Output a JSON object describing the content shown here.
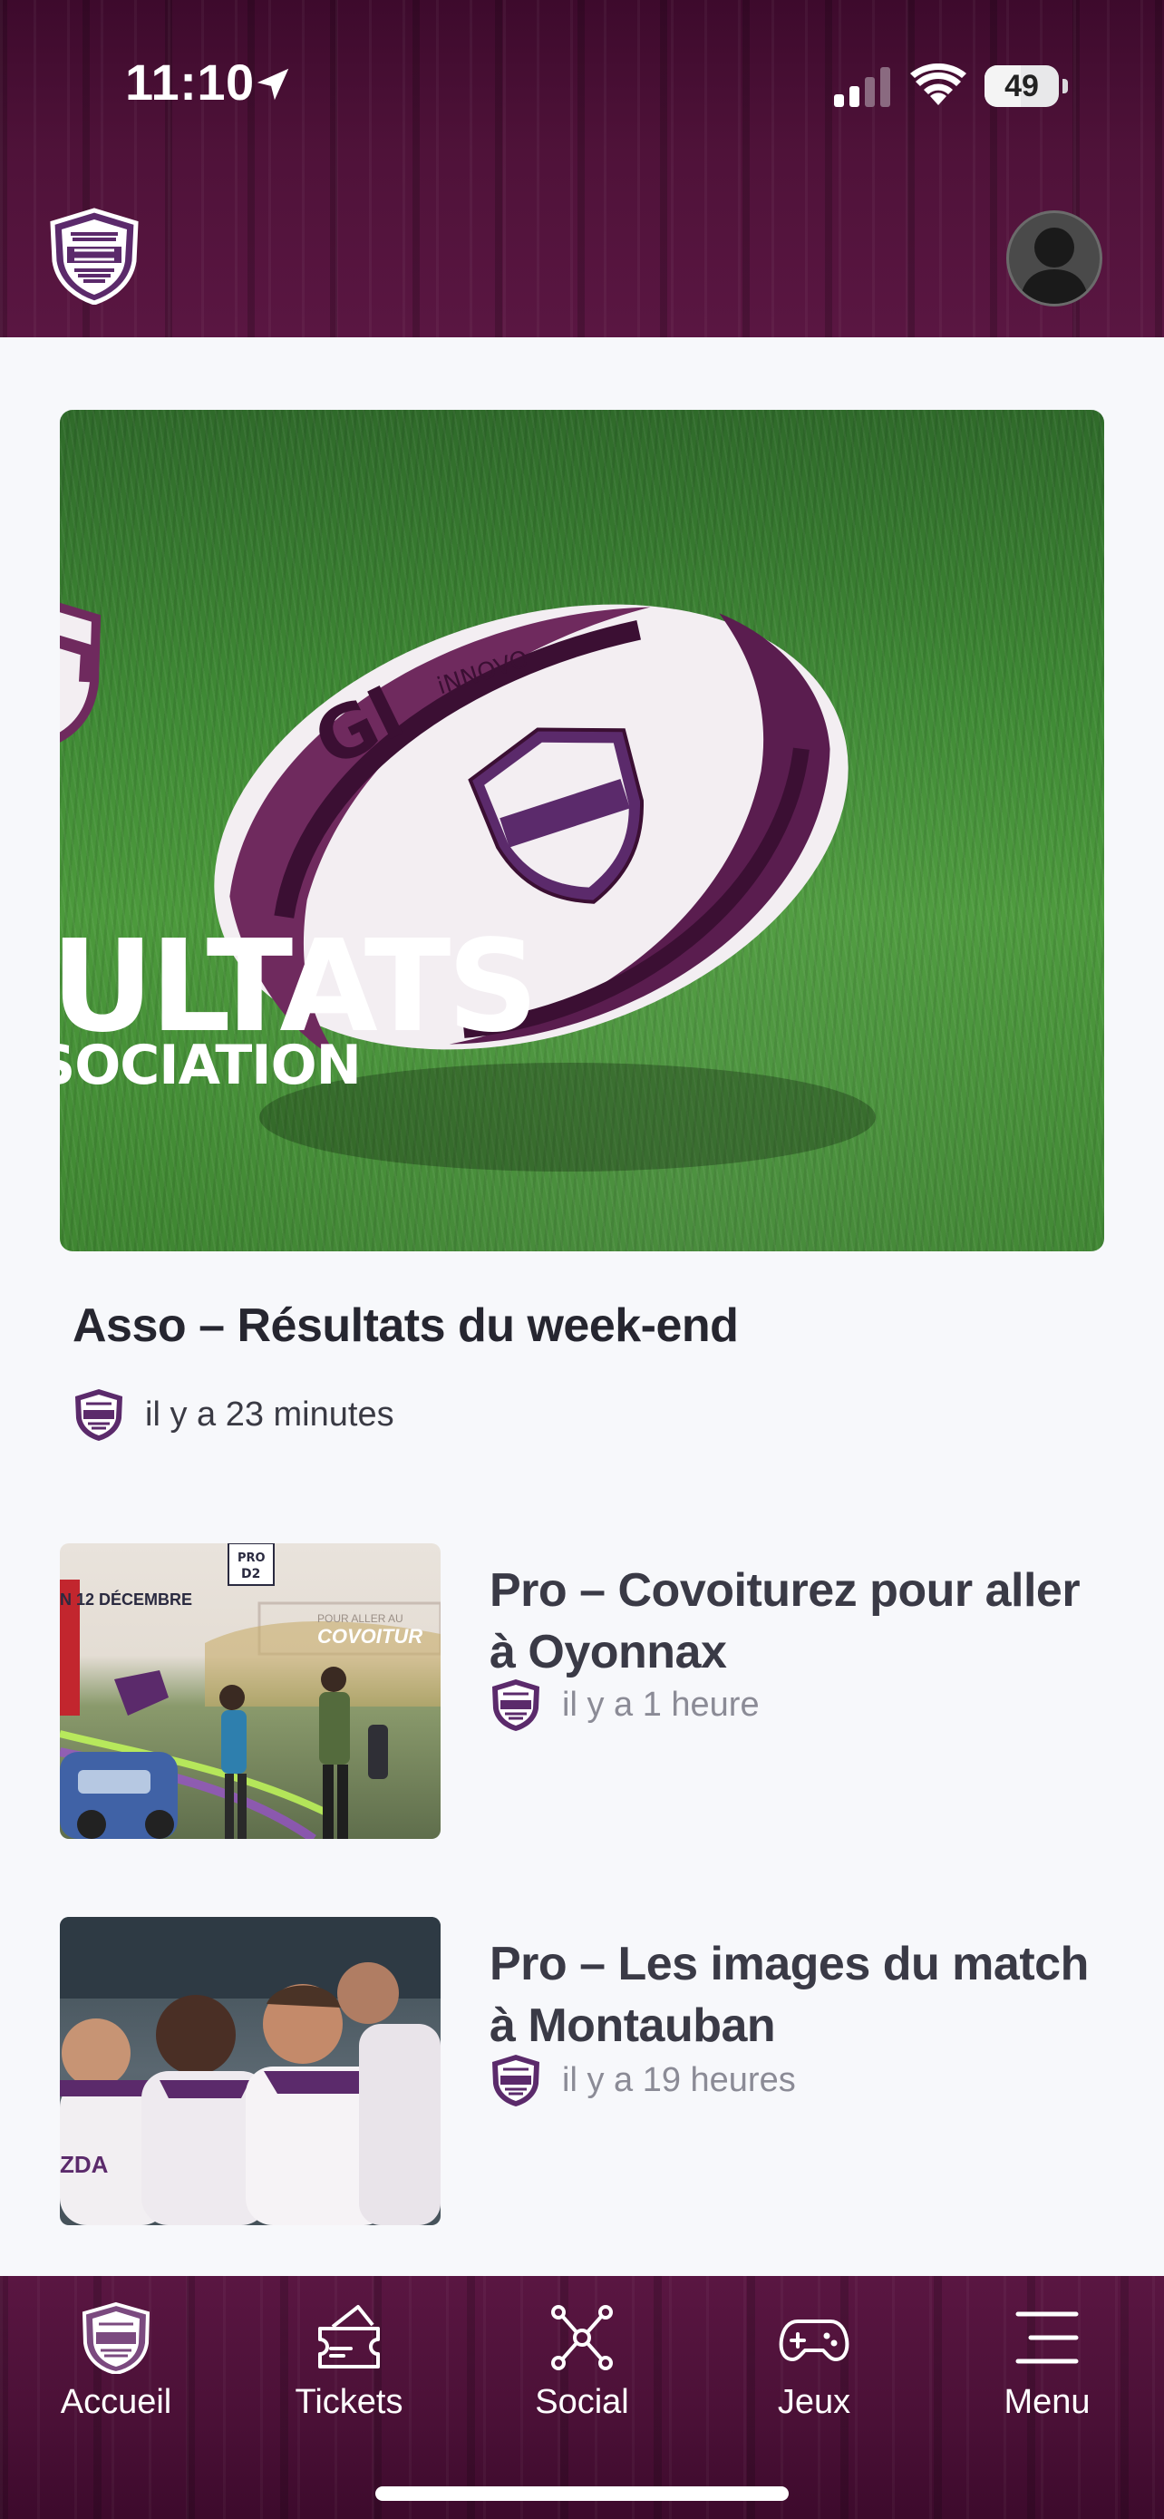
{
  "status_bar": {
    "time": "11:10",
    "battery_level": "49",
    "battery_fraction": 0.49
  },
  "header": {
    "logo_icon": "club-shield-logo",
    "avatar_icon": "user-avatar-icon"
  },
  "colors": {
    "brand_primary": "#4f1239",
    "accent_purple": "#6b2a68",
    "text_dark": "#262630",
    "text_muted": "#8b8b96"
  },
  "featured": {
    "image_text_main": "ULTATS",
    "image_text_sub": "SOCIATION",
    "title": "Asso – Résultats du week-end",
    "time": "il y a 23 minutes"
  },
  "articles": [
    {
      "title": "Pro – Covoiturez pour aller à Oyonnax",
      "time": "il y a 1 heure",
      "thumb_text_date": "N 12 DÉCEMBRE",
      "thumb_text_badge": "COVOITUR",
      "thumb_text_small": "POUR ALLER AU"
    },
    {
      "title": "Pro – Les images du match à Montauban",
      "time": "il y a 19 heures",
      "thumb_text_jersey": "ZDA"
    }
  ],
  "tabbar": {
    "items": [
      {
        "label": "Accueil",
        "icon": "club-shield-icon"
      },
      {
        "label": "Tickets",
        "icon": "ticket-icon"
      },
      {
        "label": "Social",
        "icon": "network-icon"
      },
      {
        "label": "Jeux",
        "icon": "gamepad-icon"
      },
      {
        "label": "Menu",
        "icon": "menu-icon"
      }
    ]
  }
}
